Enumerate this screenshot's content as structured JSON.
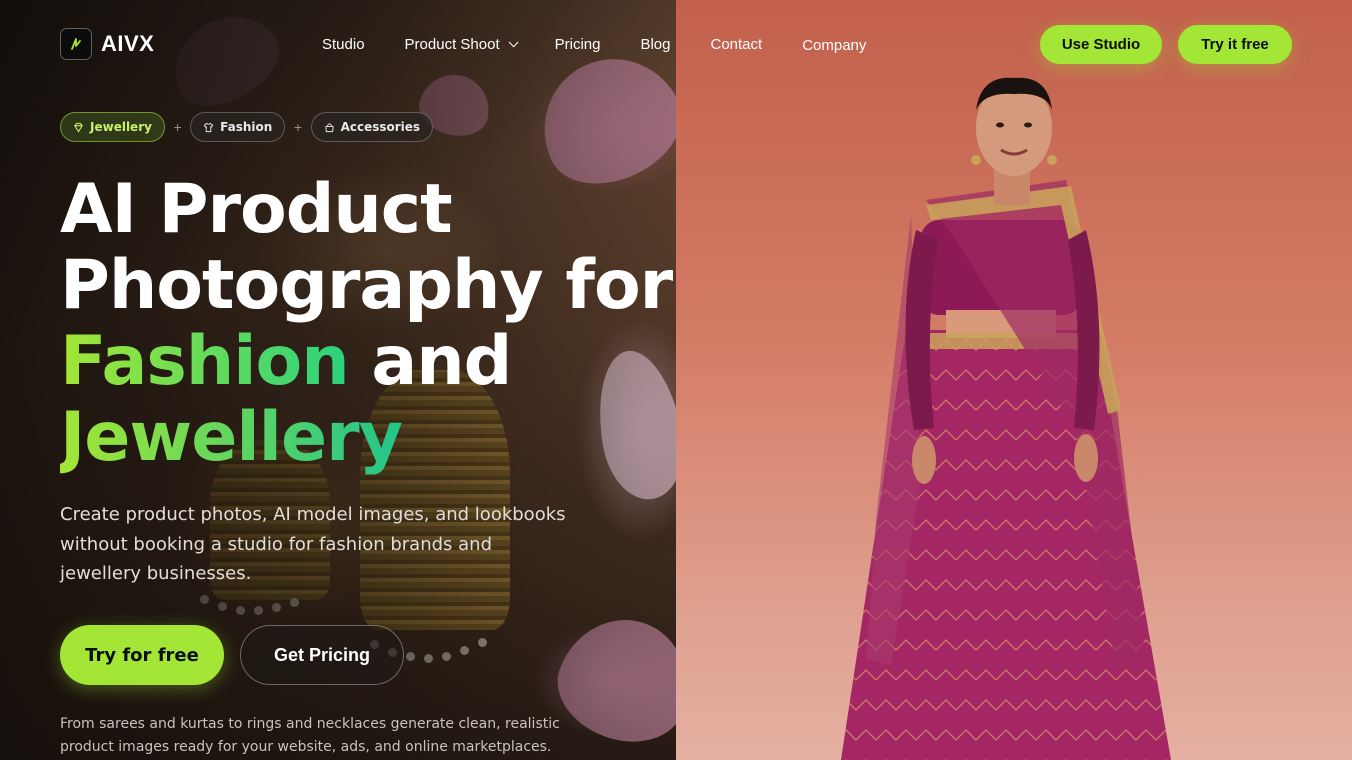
{
  "brand": {
    "name": "AIVX"
  },
  "nav": {
    "items": [
      {
        "label": "Studio"
      },
      {
        "label": "Product Shoot"
      },
      {
        "label": "Pricing"
      },
      {
        "label": "Blog"
      },
      {
        "label": "Contact"
      },
      {
        "label": "Company"
      }
    ],
    "use_studio": "Use Studio",
    "try_free": "Try it free"
  },
  "chips": [
    {
      "label": "Jewellery",
      "icon": "diamond-icon"
    },
    {
      "label": "Fashion",
      "icon": "shirt-icon"
    },
    {
      "label": "Accessories",
      "icon": "bag-icon"
    }
  ],
  "hero": {
    "line1": "AI Product",
    "line2": "Photography for",
    "highlight1": "Fashion",
    "and": " and",
    "highlight2": "Jewellery",
    "subtitle": "Create product photos, AI model images, and lookbooks without booking a studio for fashion brands and jewellery businesses.",
    "cta_primary": "Try for free",
    "cta_secondary": "Get Pricing",
    "footnote": "From sarees and kurtas to rings and necklaces generate clean, realistic product images ready for your website, ads, and online marketplaces."
  },
  "colors": {
    "accent": "#a3e635",
    "accent_gradient_end": "#22c58b"
  }
}
